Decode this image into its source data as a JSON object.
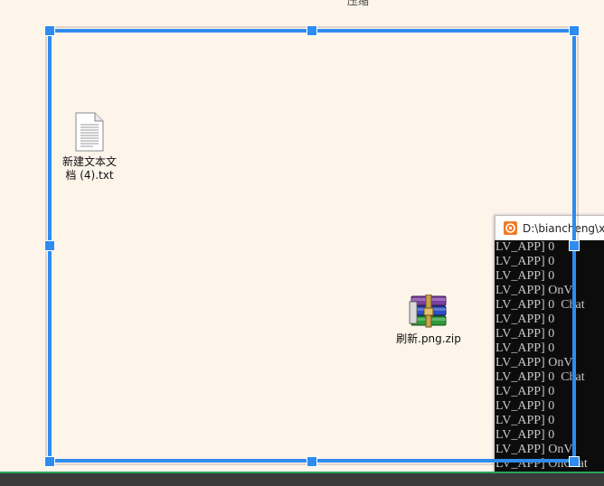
{
  "desktop": {
    "top_text_fragment": "压缩",
    "icons": [
      {
        "label": "新建文本文\n档 (4).txt",
        "icon": "text-file-icon"
      },
      {
        "label": "刷新.png.zip",
        "icon": "winrar-archive-icon"
      }
    ]
  },
  "console_window": {
    "title": "D:\\biancheng\\xm",
    "app_icon": "console-app-icon",
    "lines": [
      "LV_APP] 0",
      "LV_APP] 0",
      "LV_APP] 0",
      "LV_APP] OnV",
      "LV_APP] 0  Chat",
      "LV_APP] 0",
      "LV_APP] 0",
      "LV_APP] 0",
      "LV_APP] OnV",
      "LV_APP] 0  Chat",
      "LV_APP] 0",
      "LV_APP] 0",
      "LV_APP] 0",
      "LV_APP] 0",
      "LV_APP] OnV",
      "LV_APP] OnChat"
    ]
  },
  "selection": {
    "color": "#2e8bf0"
  },
  "taskbar": {
    "accent_color": "#27a85a"
  }
}
